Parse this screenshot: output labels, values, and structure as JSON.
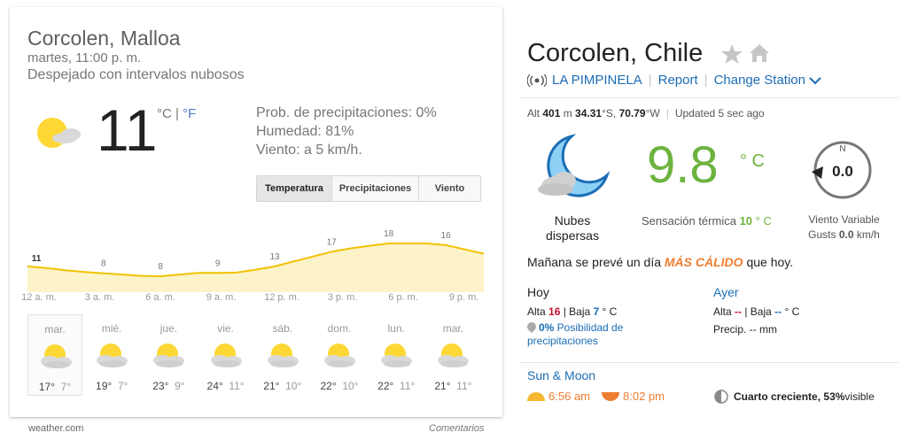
{
  "google": {
    "location": "Corcolen, Malloa",
    "datetime": "martes, 11:00 p. m.",
    "condition": "Despejado con intervalos nubosos",
    "temperature": "11",
    "unit_c": "°C",
    "unit_sep": " | ",
    "unit_f": "°F",
    "precip_prob": "Prob. de precipitaciones: 0%",
    "humidity": "Humedad: 81%",
    "wind": "Viento: a 5 km/h.",
    "tabs": [
      "Temperatura",
      "Precipitaciones",
      "Viento"
    ],
    "active_tab": "Temperatura",
    "hourly": {
      "hours": [
        "12 a. m.",
        "3 a. m.",
        "6 a. m.",
        "9 a. m.",
        "12 p. m.",
        "3 p. m.",
        "6 p. m.",
        "9 p. m."
      ],
      "labeled_temps": [
        "11",
        "8",
        "8",
        "9",
        "13",
        "17",
        "18",
        "16"
      ],
      "series": [
        11,
        10.5,
        9.8,
        9.3,
        8.9,
        8.5,
        8.1,
        8,
        8.5,
        9,
        9,
        9.1,
        10,
        11,
        12.5,
        14,
        15.5,
        16.5,
        17.3,
        18,
        18,
        18,
        17.5,
        16.2,
        14.9
      ]
    },
    "days": [
      {
        "name": "mar.",
        "hi": "17°",
        "lo": "7°"
      },
      {
        "name": "mié.",
        "hi": "19°",
        "lo": "7°"
      },
      {
        "name": "jue.",
        "hi": "23°",
        "lo": "9°"
      },
      {
        "name": "vie.",
        "hi": "24°",
        "lo": "11°"
      },
      {
        "name": "sáb.",
        "hi": "21°",
        "lo": "10°"
      },
      {
        "name": "dom.",
        "hi": "22°",
        "lo": "10°"
      },
      {
        "name": "lun.",
        "hi": "22°",
        "lo": "11°"
      },
      {
        "name": "mar.",
        "hi": "21°",
        "lo": "11°"
      }
    ],
    "brand": "weather.com",
    "feedback": "Comentarios",
    "colors": {
      "chart_line": "#f2c200",
      "chart_fill": "#fdf3c8",
      "sun": "#fdd835",
      "cloud": "#d9d9d9"
    }
  },
  "wu": {
    "title": "Corcolen, Chile",
    "station_name": "LA PIMPINELA",
    "report": "Report",
    "change_station": "Change Station",
    "meta": {
      "alt_label": "Alt ",
      "alt_value": "401",
      "alt_unit": " m  ",
      "lat": "34.31",
      "lat_dir": "°S, ",
      "lon": "70.79",
      "lon_dir": "°W",
      "updated": "Updated 5 sec ago"
    },
    "condition_lines": [
      "Nubes",
      "dispersas"
    ],
    "temp": "9.8",
    "temp_unit": "° C",
    "feels_label": "Sensación térmica ",
    "feels_value": "10",
    "feels_unit": " ° C",
    "wind_dir_label": "N",
    "wind_speed": "0.0",
    "wind_text": "Viento Variable",
    "gusts_label": "Gusts ",
    "gusts_value": "0.0",
    "gusts_unit": " km/h",
    "tomorrow_pre": "Mañana se prevé un día ",
    "tomorrow_key": "MÁS CÁLIDO",
    "tomorrow_post": " que hoy.",
    "today_heading": "Hoy",
    "today_hi_label": "Alta ",
    "today_hi": "16",
    "today_sep": " | Baja ",
    "today_lo": "7",
    "today_unit": " ° C",
    "precip_pct": "0%",
    "precip_text": " Posibilidad de precipitaciones",
    "yesterday_heading": "Ayer",
    "yest_hi_label": "Alta ",
    "yest_hi": "--",
    "yest_sep": " | Baja ",
    "yest_lo": "--",
    "yest_unit": " ° C",
    "yest_precip": "Precip. -- mm",
    "sun_moon_heading": "Sun & Moon",
    "sunrise": "6:56 am",
    "sunset": "8:02 pm",
    "moon_phase": "Cuarto creciente,",
    "moon_pct": "53%",
    "moon_visible": " visible",
    "colors": {
      "accent_blue": "#1b6db4",
      "temp_green": "#6db33f",
      "warm_orange": "#ef7d31",
      "hi_red": "#c8102e",
      "moon_icon": "#8cd0f5"
    }
  }
}
